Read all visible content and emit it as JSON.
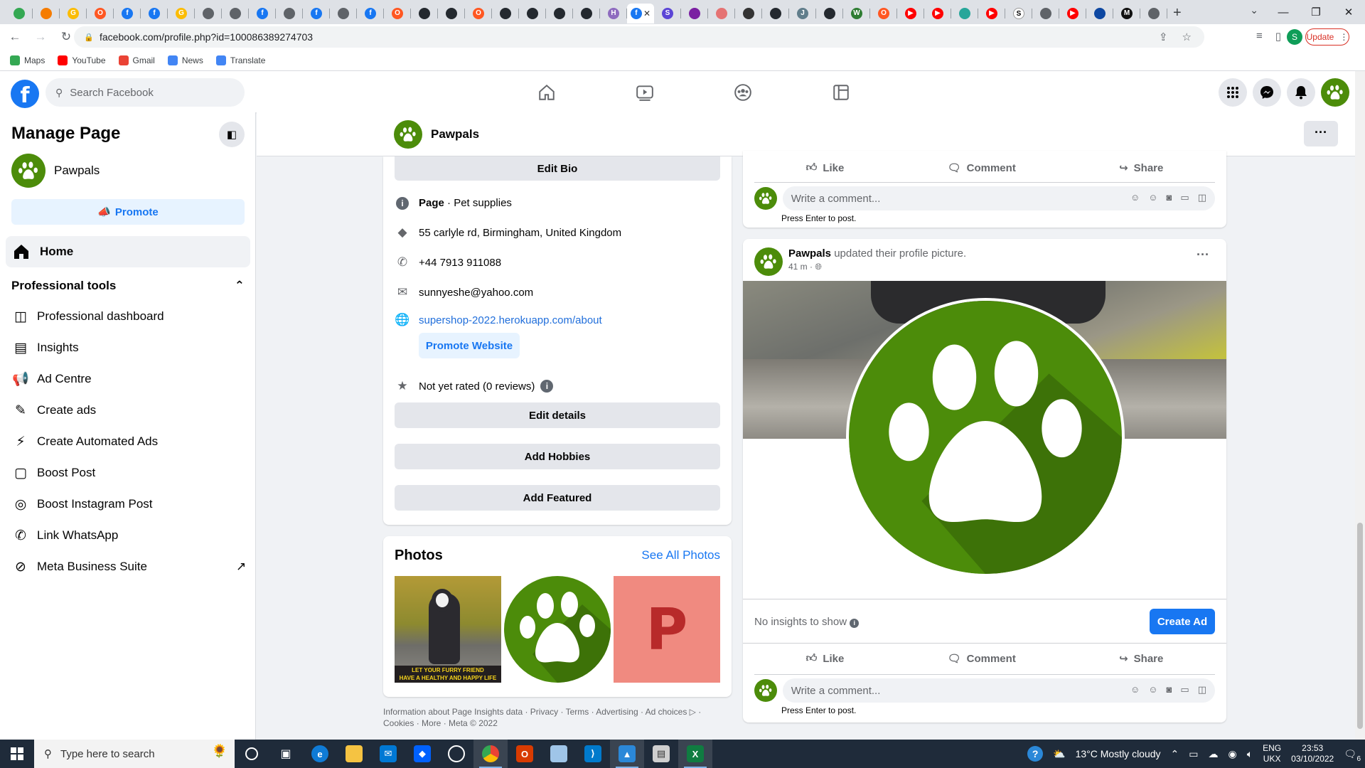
{
  "browser": {
    "url": "facebook.com/profile.php?id=100086389274703",
    "update_label": "Update",
    "bookmarks": [
      {
        "label": "Maps",
        "color": "#34a853"
      },
      {
        "label": "YouTube",
        "color": "#ff0000"
      },
      {
        "label": "Gmail",
        "color": "#ea4335"
      },
      {
        "label": "News",
        "color": "#4285f4"
      },
      {
        "label": "Translate",
        "color": "#4285f4"
      }
    ],
    "tabs": [
      {
        "icon": "maps-pin-icon",
        "color": "#34a853",
        "glyph": ""
      },
      {
        "icon": "box-icon",
        "color": "#f57c00",
        "glyph": ""
      },
      {
        "icon": "google-icon",
        "color": "#fbbc05",
        "glyph": "G"
      },
      {
        "icon": "circle-icon",
        "color": "#ff5722",
        "glyph": "O"
      },
      {
        "icon": "facebook-icon",
        "color": "#1877f2",
        "glyph": "f"
      },
      {
        "icon": "facebook-icon",
        "color": "#1877f2",
        "glyph": "f"
      },
      {
        "icon": "google-icon",
        "color": "#fbbc05",
        "glyph": "G"
      },
      {
        "icon": "globe-icon",
        "color": "#5f6368",
        "glyph": ""
      },
      {
        "icon": "globe-icon",
        "color": "#5f6368",
        "glyph": ""
      },
      {
        "icon": "facebook-icon",
        "color": "#1877f2",
        "glyph": "f"
      },
      {
        "icon": "globe-icon",
        "color": "#5f6368",
        "glyph": ""
      },
      {
        "icon": "facebook-icon",
        "color": "#1877f2",
        "glyph": "f"
      },
      {
        "icon": "globe-icon",
        "color": "#5f6368",
        "glyph": ""
      },
      {
        "icon": "facebook-icon",
        "color": "#1877f2",
        "glyph": "f"
      },
      {
        "icon": "circle-icon",
        "color": "#ff5722",
        "glyph": "O"
      },
      {
        "icon": "github-icon",
        "color": "#24292f",
        "glyph": ""
      },
      {
        "icon": "github-icon",
        "color": "#24292f",
        "glyph": ""
      },
      {
        "icon": "circle-icon",
        "color": "#ff5722",
        "glyph": "O"
      },
      {
        "icon": "github-icon",
        "color": "#24292f",
        "glyph": ""
      },
      {
        "icon": "github-icon",
        "color": "#24292f",
        "glyph": ""
      },
      {
        "icon": "github-icon",
        "color": "#24292f",
        "glyph": ""
      },
      {
        "icon": "github-icon",
        "color": "#24292f",
        "glyph": ""
      },
      {
        "icon": "h-icon",
        "color": "#8e6bbf",
        "glyph": "H"
      }
    ],
    "tabs_after": [
      {
        "icon": "s-icon",
        "color": "#5b45d6",
        "glyph": "S"
      },
      {
        "icon": "mail-icon",
        "color": "#7b1fa2",
        "glyph": ""
      },
      {
        "icon": "dash-icon",
        "color": "#e57373",
        "glyph": ""
      },
      {
        "icon": "quill-icon",
        "color": "#333333",
        "glyph": ""
      },
      {
        "icon": "github-icon",
        "color": "#24292f",
        "glyph": ""
      },
      {
        "icon": "jd-icon",
        "color": "#607d8b",
        "glyph": "J"
      },
      {
        "icon": "github-icon",
        "color": "#24292f",
        "glyph": ""
      },
      {
        "icon": "w-icon",
        "color": "#2e7d32",
        "glyph": "W"
      },
      {
        "icon": "circle-icon",
        "color": "#ff5722",
        "glyph": "O"
      },
      {
        "icon": "youtube-icon",
        "color": "#ff0000",
        "glyph": "▶"
      },
      {
        "icon": "youtube-icon",
        "color": "#ff0000",
        "glyph": "▶"
      },
      {
        "icon": "copy-icon",
        "color": "#26a69a",
        "glyph": ""
      },
      {
        "icon": "youtube-icon",
        "color": "#ff0000",
        "glyph": "▶"
      },
      {
        "icon": "s-icon",
        "color": "#ffffff",
        "glyph": "S"
      },
      {
        "icon": "chrome-icon",
        "color": "#5f6368",
        "glyph": ""
      },
      {
        "icon": "youtube-icon",
        "color": "#ff0000",
        "glyph": "▶"
      },
      {
        "icon": "link-icon",
        "color": "#0d47a1",
        "glyph": ""
      },
      {
        "icon": "m-icon",
        "color": "#111111",
        "glyph": "M"
      },
      {
        "icon": "speaker-icon",
        "color": "#5f6368",
        "glyph": ""
      }
    ]
  },
  "fb": {
    "search_placeholder": "Search Facebook",
    "page_name": "Pawpals",
    "sidebar": {
      "title": "Manage Page",
      "promote": "Promote",
      "home": "Home",
      "section": "Professional tools",
      "items": [
        {
          "label": "Professional dashboard",
          "icon": "dashboard-icon",
          "glyph": "◫"
        },
        {
          "label": "Insights",
          "icon": "insights-icon",
          "glyph": "▤"
        },
        {
          "label": "Ad Centre",
          "icon": "megaphone-icon",
          "glyph": "📢"
        },
        {
          "label": "Create ads",
          "icon": "pencil-icon",
          "glyph": "✎"
        },
        {
          "label": "Create Automated Ads",
          "icon": "magic-wand-icon",
          "glyph": "⚡"
        },
        {
          "label": "Boost Post",
          "icon": "boost-icon",
          "glyph": "▢"
        },
        {
          "label": "Boost Instagram Post",
          "icon": "instagram-icon",
          "glyph": "◎"
        },
        {
          "label": "Link WhatsApp",
          "icon": "whatsapp-icon",
          "glyph": "✆"
        },
        {
          "label": "Meta Business Suite",
          "icon": "meta-business-icon",
          "glyph": "⊘"
        }
      ]
    },
    "intro": {
      "edit_bio": "Edit Bio",
      "category_bold": "Page",
      "category": " · Pet supplies",
      "address": "55 carlyle rd, Birmingham, United Kingdom",
      "phone": "+44 7913 911088",
      "email": "sunnyeshe@yahoo.com",
      "website": "supershop-2022.herokuapp.com/about",
      "promote_website": "Promote Website",
      "rating": "Not yet rated (0 reviews)",
      "edit_details": "Edit details",
      "add_hobbies": "Add Hobbies",
      "add_featured": "Add Featured"
    },
    "photos": {
      "title": "Photos",
      "see_all": "See All Photos",
      "caption_line1": "LET YOUR FURRY FRIEND",
      "caption_line2": "HAVE A HEALTHY AND HAPPY LIFE",
      "letter": "P"
    },
    "footer": "Information about Page Insights data · Privacy · Terms · Advertising · Ad choices ▷ · Cookies · More · Meta © 2022",
    "post_actions": {
      "like": "Like",
      "comment": "Comment",
      "share": "Share"
    },
    "comment_placeholder": "Write a comment...",
    "press_enter": "Press Enter to post.",
    "post": {
      "author": "Pawpals",
      "action": " updated their profile picture.",
      "time": "41 m ·",
      "no_insights": "No insights to show",
      "create_ad": "Create Ad"
    }
  },
  "taskbar": {
    "search_placeholder": "Type here to search",
    "weather": "13°C  Mostly cloudy",
    "lang1": "ENG",
    "lang2": "UKX",
    "time": "23:53",
    "date": "03/10/2022",
    "notif_count": "6"
  }
}
